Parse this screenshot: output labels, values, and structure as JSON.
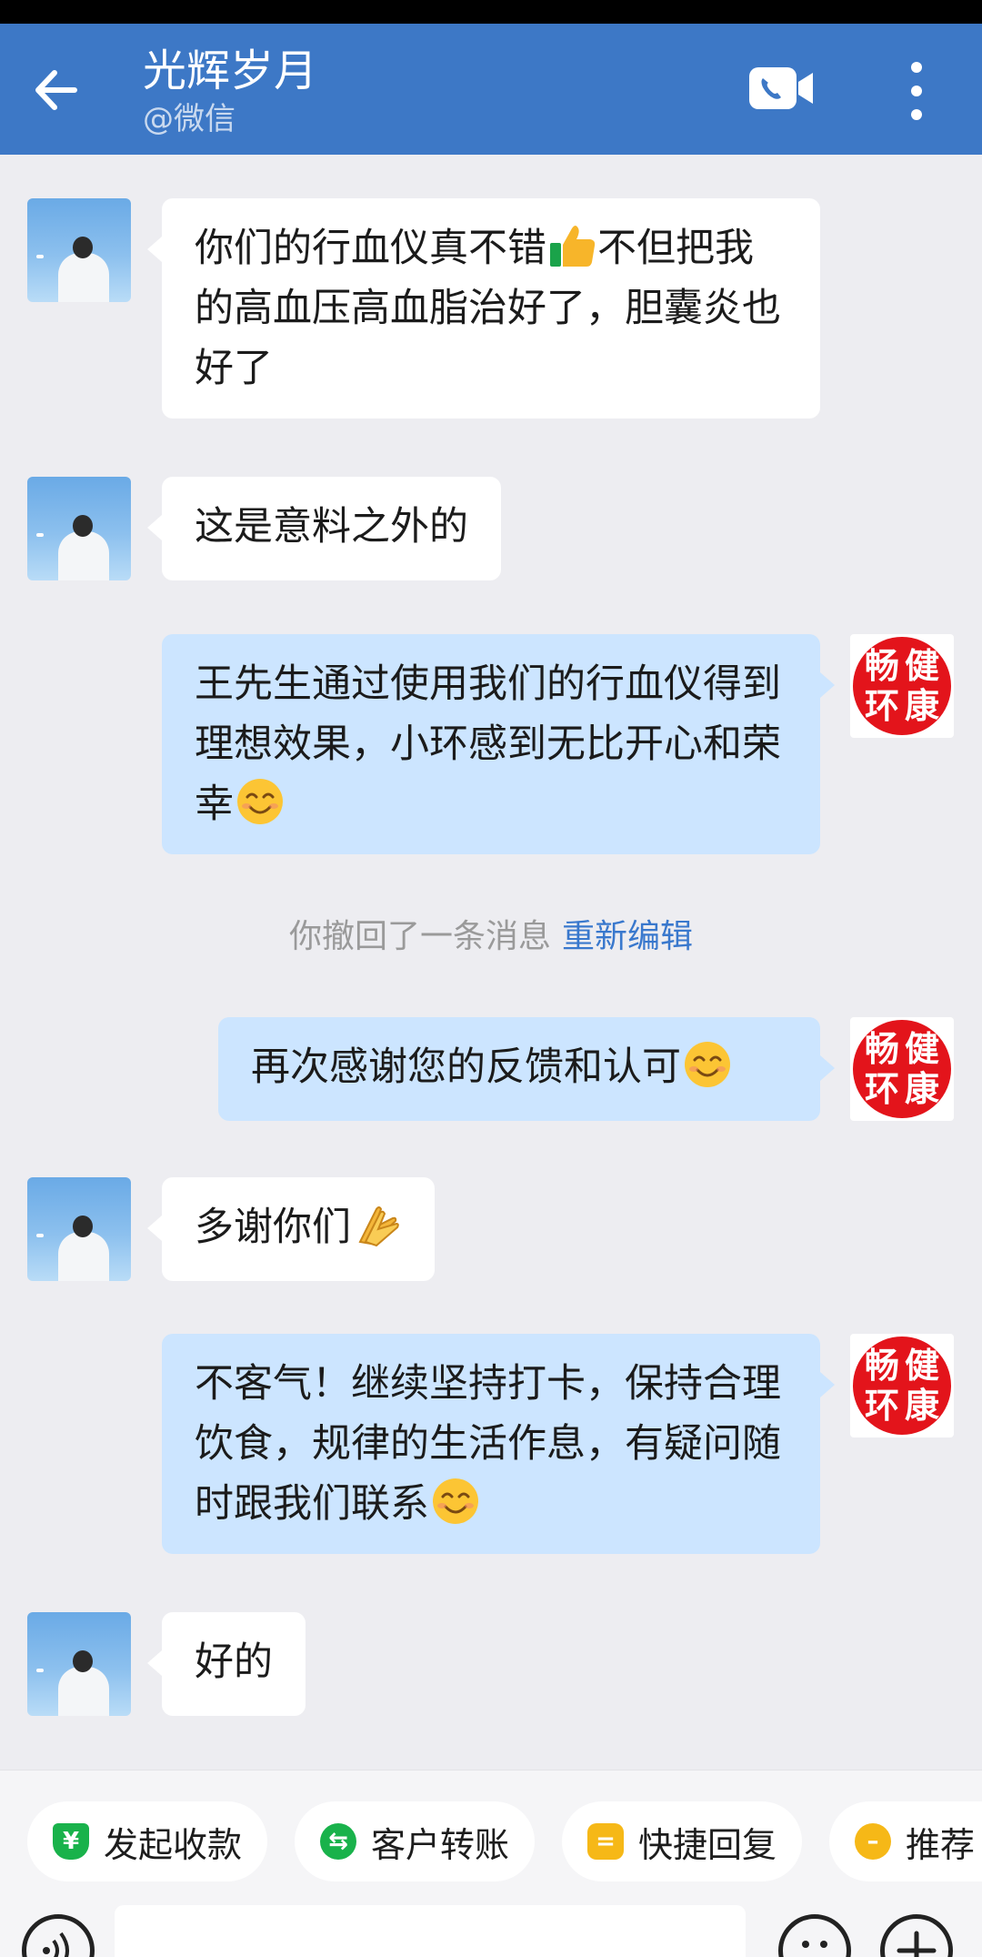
{
  "header": {
    "title": "光辉岁月",
    "subtitle": "@微信",
    "color": "#3d78c6"
  },
  "brand_avatar": {
    "line1": "畅环",
    "line2": "健康",
    "color": "#e3141b"
  },
  "messages": [
    {
      "side": "in",
      "text": "你们的行血仪真不错",
      "emoji": "thumbs-up-icon",
      "text_after": "不但把我的高血压高血脂治好了，胆囊炎也好了"
    },
    {
      "side": "in",
      "text": "这是意料之外的"
    },
    {
      "side": "out",
      "text": "王先生通过使用我们的行血仪得到理想效果，小环感到无比开心和荣幸",
      "emoji": "smile-icon"
    },
    {
      "side": "out",
      "text": "再次感谢您的反馈和认可",
      "emoji": "smile-icon"
    },
    {
      "side": "in",
      "text": "多谢你们",
      "emoji": "pray-hands-icon"
    },
    {
      "side": "out",
      "text": "不客气！继续坚持打卡，保持合理饮食，规律的生活作息，有疑问随时跟我们联系",
      "emoji": "smile-icon"
    },
    {
      "side": "in",
      "text": "好的"
    }
  ],
  "recall": {
    "text": "你撤回了一条消息",
    "action": "重新编辑"
  },
  "toolbar": {
    "chips": [
      {
        "label": "发起收款",
        "icon": "yen-shield-icon",
        "color": "#19b24b"
      },
      {
        "label": "客户转账",
        "icon": "transfer-icon",
        "color": "#19b24b"
      },
      {
        "label": "快捷回复",
        "icon": "quick-reply-icon",
        "color": "#f6b817"
      },
      {
        "label": "推荐",
        "icon": "recommend-icon",
        "color": "#f6b817"
      }
    ]
  },
  "colors": {
    "incoming_bubble": "#ffffff",
    "outgoing_bubble": "#cce5ff",
    "chat_bg": "#ededf1",
    "link": "#3978cd"
  }
}
